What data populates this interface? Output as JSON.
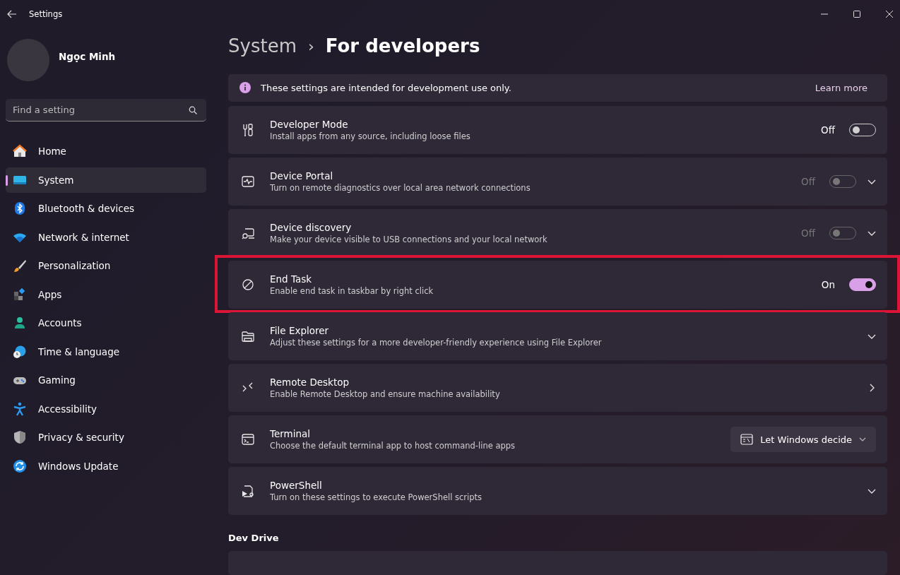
{
  "window": {
    "title": "Settings"
  },
  "user": {
    "name": "Ngọc Minh"
  },
  "search": {
    "placeholder": "Find a setting"
  },
  "sidebar": {
    "items": [
      {
        "label": "Home",
        "selected": false
      },
      {
        "label": "System",
        "selected": true
      },
      {
        "label": "Bluetooth & devices",
        "selected": false
      },
      {
        "label": "Network & internet",
        "selected": false
      },
      {
        "label": "Personalization",
        "selected": false
      },
      {
        "label": "Apps",
        "selected": false
      },
      {
        "label": "Accounts",
        "selected": false
      },
      {
        "label": "Time & language",
        "selected": false
      },
      {
        "label": "Gaming",
        "selected": false
      },
      {
        "label": "Accessibility",
        "selected": false
      },
      {
        "label": "Privacy & security",
        "selected": false
      },
      {
        "label": "Windows Update",
        "selected": false
      }
    ]
  },
  "breadcrumb": {
    "parent": "System",
    "separator": "›",
    "current": "For developers"
  },
  "info_bar": {
    "text": "These settings are intended for development use only.",
    "link": "Learn more"
  },
  "rows": [
    {
      "kind": "toggle",
      "title": "Developer Mode",
      "description": "Install apps from any source, including loose files",
      "state_label": "Off",
      "on": false,
      "disabled": false,
      "highlighted": false
    },
    {
      "kind": "toggle_expand",
      "title": "Device Portal",
      "description": "Turn on remote diagnostics over local area network connections",
      "state_label": "Off",
      "on": false,
      "disabled": true,
      "highlighted": false
    },
    {
      "kind": "toggle_expand",
      "title": "Device discovery",
      "description": "Make your device visible to USB connections and your local network",
      "state_label": "Off",
      "on": false,
      "disabled": true,
      "highlighted": false
    },
    {
      "kind": "toggle",
      "title": "End Task",
      "description": "Enable end task in taskbar by right click",
      "state_label": "On",
      "on": true,
      "disabled": false,
      "highlighted": true
    },
    {
      "kind": "expand",
      "title": "File Explorer",
      "description": "Adjust these settings for a more developer-friendly experience using File Explorer",
      "highlighted": false
    },
    {
      "kind": "link",
      "title": "Remote Desktop",
      "description": "Enable Remote Desktop and ensure machine availability",
      "highlighted": false
    },
    {
      "kind": "dropdown",
      "title": "Terminal",
      "description": "Choose the default terminal app to host command-line apps",
      "value": "Let Windows decide",
      "highlighted": false
    },
    {
      "kind": "expand",
      "title": "PowerShell",
      "description": "Turn on these settings to execute PowerShell scripts",
      "highlighted": false
    }
  ],
  "section": {
    "title": "Dev Drive"
  }
}
